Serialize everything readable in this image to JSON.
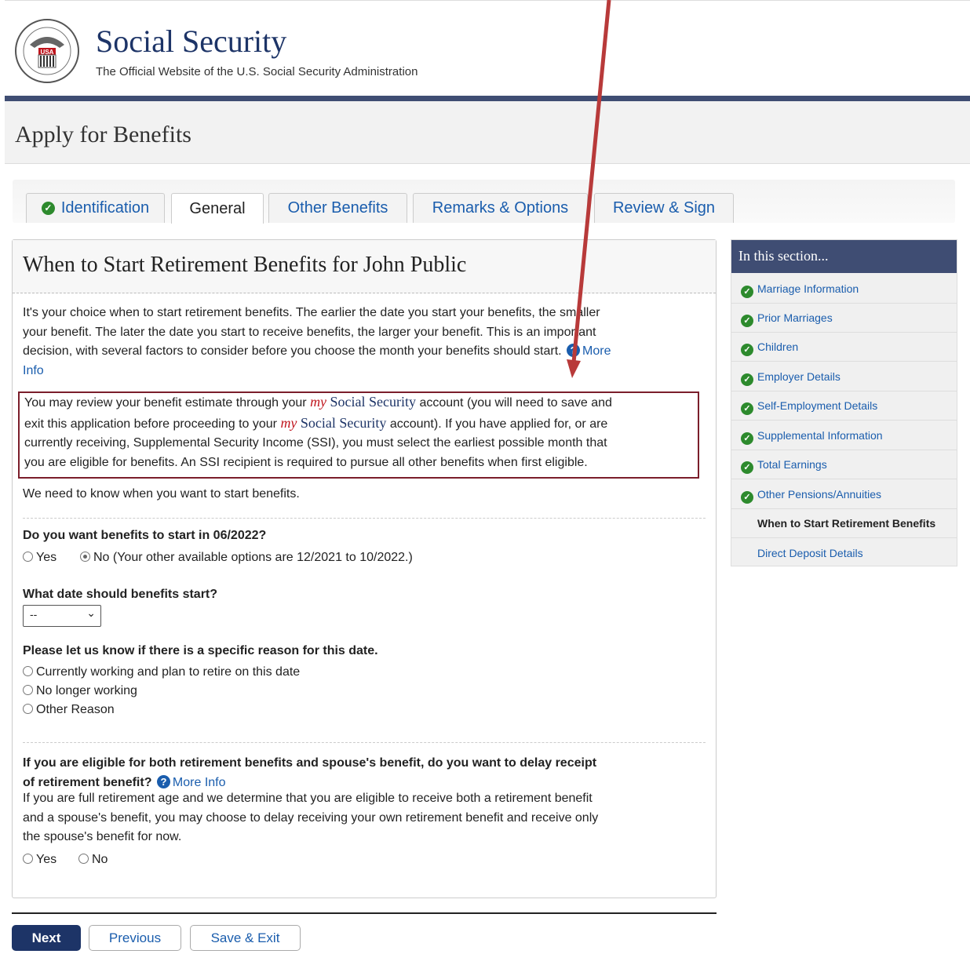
{
  "header": {
    "title": "Social Security",
    "subtitle": "The Official Website of the U.S. Social Security Administration",
    "seal_text": "USA"
  },
  "page_title": "Apply for Benefits",
  "tabs": [
    {
      "label": "Identification",
      "completed": true
    },
    {
      "label": "General",
      "active": true
    },
    {
      "label": "Other Benefits"
    },
    {
      "label": "Remarks & Options"
    },
    {
      "label": "Review & Sign"
    }
  ],
  "main": {
    "heading": "When to Start Retirement Benefits for John Public",
    "intro_1": "It's your choice when to start retirement benefits. The earlier the date you start your benefits, the smaller",
    "intro_2": "your benefit. The later the date you start to receive benefits, the larger your benefit. This is an important",
    "intro_3": "decision, with several factors to consider before you choose the month your benefits should start.",
    "more_info_1": "More",
    "more_info_2": "Info",
    "notice": {
      "l1_a": "You may review your benefit estimate through your",
      "my": "my",
      "social_security": "Social Security",
      "l1_b": "account (you will need to save and",
      "l2_a": "exit this application before proceeding to your",
      "l2_b": "account). If you have applied for, or are",
      "l3": "currently receiving, Supplemental Security Income (SSI), you must select the earliest possible month that",
      "l4": "you are eligible for benefits. An SSI recipient is required to pursue all other benefits when first eligible."
    },
    "need_to_know": "We need to know when you want to start benefits.",
    "q1": {
      "label": "Do you want benefits to start in 06/2022?",
      "yes": "Yes",
      "no": "No (Your other available options are 12/2021 to 10/2022.)",
      "selected": "No"
    },
    "q2": {
      "label": "What date should benefits start?",
      "selected_value": "--"
    },
    "q3": {
      "label": "Please let us know if there is a specific reason for this date.",
      "options": [
        "Currently working and plan to retire on this date",
        "No longer working",
        "Other Reason"
      ]
    },
    "q4": {
      "label_1": "If you are eligible for both retirement benefits and spouse's benefit, do you want to delay receipt",
      "label_2": "of retirement benefit?",
      "more_info": "More Info",
      "desc_1": "If you are full retirement age and we determine that you are eligible to receive both a retirement benefit",
      "desc_2": "and a spouse's benefit, you may choose to delay receiving your own retirement benefit and receive only",
      "desc_3": "the spouse's benefit for now.",
      "yes": "Yes",
      "no": "No"
    }
  },
  "sidenav": {
    "title": "In this section...",
    "items": [
      {
        "label": "Marriage Information",
        "completed": true
      },
      {
        "label": "Prior Marriages",
        "completed": true
      },
      {
        "label": "Children",
        "completed": true
      },
      {
        "label": "Employer Details",
        "completed": true
      },
      {
        "label": "Self-Employment Details",
        "completed": true
      },
      {
        "label": "Supplemental Information",
        "completed": true
      },
      {
        "label": "Total Earnings",
        "completed": true
      },
      {
        "label": "Other Pensions/Annuities",
        "completed": true
      },
      {
        "label": "When to Start Retirement Benefits",
        "current": true
      },
      {
        "label": "Direct Deposit Details"
      }
    ]
  },
  "footer": {
    "next": "Next",
    "previous": "Previous",
    "save_exit": "Save & Exit"
  },
  "colors": {
    "brand_navy": "#1d3467",
    "link_blue": "#1a5dad",
    "check_green": "#2d8a2d",
    "notice_border": "#7b1e2b",
    "annotation_arrow": "#b83a3a"
  }
}
